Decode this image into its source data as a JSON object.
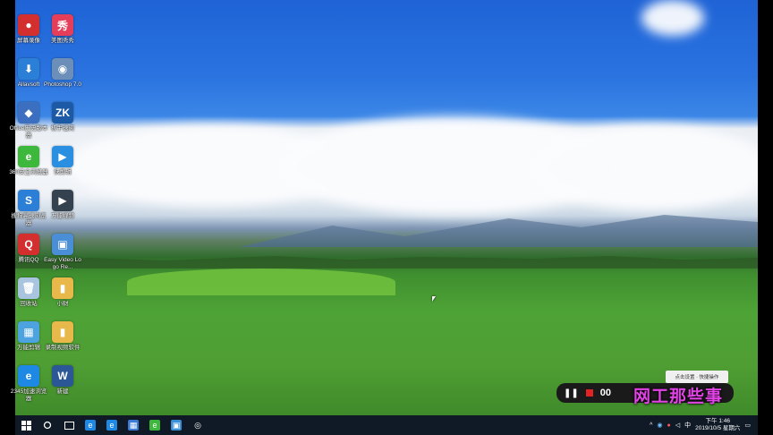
{
  "desktop": {
    "icons": [
      {
        "label": "屏幕录像",
        "color": "#d32f2f",
        "glyph": "●",
        "icon": "record-icon"
      },
      {
        "label": "美图秀秀",
        "color": "#e53e5b",
        "glyph": "秀",
        "icon": "meitu-icon"
      },
      {
        "label": "Allavsoft",
        "color": "#2b7fd6",
        "glyph": "⬇",
        "icon": "allavsoft-icon"
      },
      {
        "label": "Photoshop 7.0",
        "color": "#6b8fb8",
        "glyph": "◉",
        "icon": "photoshop-icon"
      },
      {
        "label": "Office历史版本器",
        "color": "#3d6fc1",
        "glyph": "◆",
        "icon": "office-icon"
      },
      {
        "label": "极手速阅",
        "color": "#1c5aa6",
        "glyph": "ZK",
        "icon": "zkbd-icon"
      },
      {
        "label": "360安全浏览器",
        "color": "#3db83d",
        "glyph": "e",
        "icon": "browser-360-icon"
      },
      {
        "label": "快剪辑",
        "color": "#2a8fe0",
        "glyph": "▶",
        "icon": "kuaijianji-icon"
      },
      {
        "label": "搜狗高速浏览器",
        "color": "#2b7fd6",
        "glyph": "S",
        "icon": "sogou-icon"
      },
      {
        "label": "万能视频",
        "color": "#34424f",
        "glyph": "▶",
        "icon": "video-icon"
      },
      {
        "label": "腾讯QQ",
        "color": "#d32f2f",
        "glyph": "Q",
        "icon": "qq-icon"
      },
      {
        "label": "Easy Video Logo Re...",
        "color": "#4a8fd6",
        "glyph": "▣",
        "icon": "easy-video-icon"
      },
      {
        "label": "回收站",
        "color": "#a9c4de",
        "glyph": "🗑",
        "icon": "recycle-bin-icon"
      },
      {
        "label": "小财",
        "color": "#e8b94a",
        "glyph": "▮",
        "icon": "folder-icon"
      },
      {
        "label": "万能剪辑",
        "color": "#4da3e0",
        "glyph": "▦",
        "icon": "editor-icon"
      },
      {
        "label": "录制视频软件",
        "color": "#e8b94a",
        "glyph": "▮",
        "icon": "folder-icon"
      },
      {
        "label": "2345加速浏览器",
        "color": "#1e88e5",
        "glyph": "e",
        "icon": "browser-2345-icon"
      },
      {
        "label": "新建",
        "color": "#2b5797",
        "glyph": "W",
        "icon": "word-doc-icon"
      }
    ]
  },
  "taskbar": {
    "start_icon": "windows-start-icon",
    "search_icon": "search-icon",
    "apps": [
      {
        "name": "edge",
        "color": "#1e88e5",
        "glyph": "e"
      },
      {
        "name": "ie",
        "color": "#1e88e5",
        "glyph": "e"
      },
      {
        "name": "store",
        "color": "#3a7bd5",
        "glyph": "▦"
      },
      {
        "name": "360",
        "color": "#3db83d",
        "glyph": "e"
      },
      {
        "name": "pinned",
        "color": "#3a8fd6",
        "glyph": "▣"
      },
      {
        "name": "recorder",
        "color": "#ffffff",
        "glyph": "◎"
      }
    ],
    "clock_time": "下午 1:46",
    "clock_date": "2019/10/5 星期六"
  },
  "recorder": {
    "pause": "❚❚",
    "time": "00",
    "tooltip": "点击设置 · 快捷操作"
  },
  "watermark": "网工那些事"
}
